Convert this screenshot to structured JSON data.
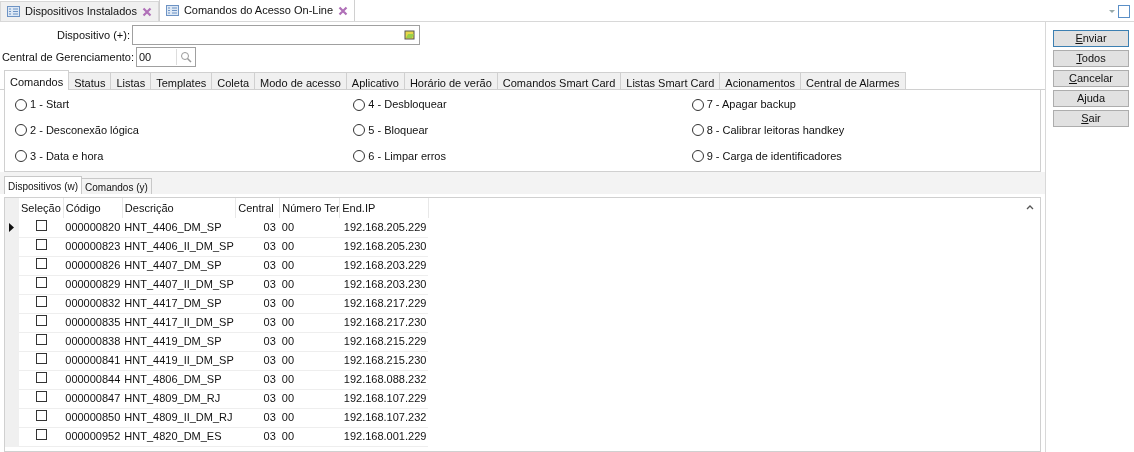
{
  "doc_tabs": [
    {
      "label": "Dispositivos Instalados",
      "selected": false
    },
    {
      "label": "Comandos do Acesso On-Line",
      "selected": true
    }
  ],
  "form": {
    "dispositivo": {
      "label": "Dispositivo (+):"
    },
    "central": {
      "label": "Central de Gerenciamento:",
      "value": "00"
    }
  },
  "tabs": [
    {
      "label": "Comandos",
      "selected": true
    },
    {
      "label": "Status",
      "selected": false
    },
    {
      "label": "Listas",
      "selected": false
    },
    {
      "label": "Templates",
      "selected": false
    },
    {
      "label": "Coleta",
      "selected": false
    },
    {
      "label": "Modo de acesso",
      "selected": false
    },
    {
      "label": "Aplicativo",
      "selected": false
    },
    {
      "label": "Horário de verão",
      "selected": false
    },
    {
      "label": "Comandos Smart Card",
      "selected": false
    },
    {
      "label": "Listas Smart Card",
      "selected": false
    },
    {
      "label": "Acionamentos",
      "selected": false
    },
    {
      "label": "Central de Alarmes",
      "selected": false
    }
  ],
  "commands": [
    {
      "label": "1 - Start",
      "selected": false
    },
    {
      "label": "2 - Desconexão lógica",
      "selected": false
    },
    {
      "label": "3 - Data e hora",
      "selected": false
    },
    {
      "label": "4 - Desbloquear",
      "selected": false
    },
    {
      "label": "5 - Bloquear",
      "selected": false
    },
    {
      "label": "6 - Limpar erros",
      "selected": false
    },
    {
      "label": "7 - Apagar backup",
      "selected": false
    },
    {
      "label": "8 - Calibrar leitoras handkey",
      "selected": false
    },
    {
      "label": "9 - Carga de identificadores",
      "selected": false
    }
  ],
  "sub_tabs": [
    {
      "label": "Dispositivos (w)",
      "selected": true
    },
    {
      "label": "Comandos (y)",
      "selected": false
    }
  ],
  "table": {
    "selection_column": "Seleção",
    "columns": [
      "Código",
      "Descrição",
      "Central",
      "Número Ter",
      "End.IP"
    ],
    "rows": [
      {
        "current": true,
        "checked": false,
        "cells": [
          "000000820",
          "HNT_4406_DM_SP",
          "03",
          "00",
          "192.168.205.229"
        ]
      },
      {
        "current": false,
        "checked": false,
        "cells": [
          "000000823",
          "HNT_4406_II_DM_SP",
          "03",
          "00",
          "192.168.205.230"
        ]
      },
      {
        "current": false,
        "checked": false,
        "cells": [
          "000000826",
          "HNT_4407_DM_SP",
          "03",
          "00",
          "192.168.203.229"
        ]
      },
      {
        "current": false,
        "checked": false,
        "cells": [
          "000000829",
          "HNT_4407_II_DM_SP",
          "03",
          "00",
          "192.168.203.230"
        ]
      },
      {
        "current": false,
        "checked": false,
        "cells": [
          "000000832",
          "HNT_4417_DM_SP",
          "03",
          "00",
          "192.168.217.229"
        ]
      },
      {
        "current": false,
        "checked": false,
        "cells": [
          "000000835",
          "HNT_4417_II_DM_SP",
          "03",
          "00",
          "192.168.217.230"
        ]
      },
      {
        "current": false,
        "checked": false,
        "cells": [
          "000000838",
          "HNT_4419_DM_SP",
          "03",
          "00",
          "192.168.215.229"
        ]
      },
      {
        "current": false,
        "checked": false,
        "cells": [
          "000000841",
          "HNT_4419_II_DM_SP",
          "03",
          "00",
          "192.168.215.230"
        ]
      },
      {
        "current": false,
        "checked": false,
        "cells": [
          "000000844",
          "HNT_4806_DM_SP",
          "03",
          "00",
          "192.168.088.232"
        ]
      },
      {
        "current": false,
        "checked": false,
        "cells": [
          "000000847",
          "HNT_4809_DM_RJ",
          "03",
          "00",
          "192.168.107.229"
        ]
      },
      {
        "current": false,
        "checked": false,
        "cells": [
          "000000850",
          "HNT_4809_II_DM_RJ",
          "03",
          "00",
          "192.168.107.232"
        ]
      },
      {
        "current": false,
        "checked": false,
        "cells": [
          "000000952",
          "HNT_4820_DM_ES",
          "03",
          "00",
          "192.168.001.229"
        ]
      }
    ]
  },
  "buttons": [
    {
      "label": "Enviar",
      "default": true
    },
    {
      "label": "Todos",
      "default": false
    },
    {
      "label": "Cancelar",
      "default": false
    },
    {
      "label": "Ajuda",
      "default": false
    },
    {
      "label": "Sair",
      "default": false
    }
  ]
}
